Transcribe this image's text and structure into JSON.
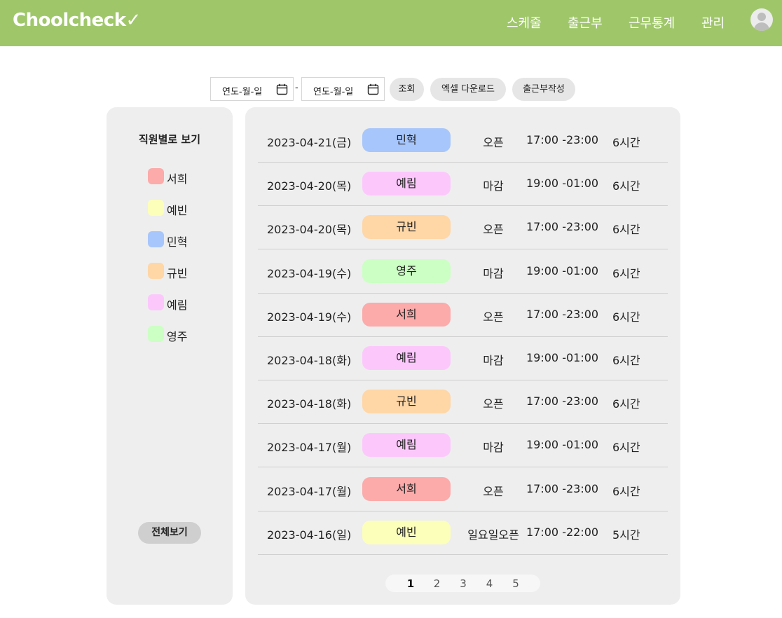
{
  "header": {
    "logo": "Choolcheck✓",
    "nav": [
      "스케줄",
      "출근부",
      "근무통계",
      "관리"
    ]
  },
  "toolbar": {
    "date_start_placeholder": "연도-월-일",
    "date_end_placeholder": "연도-월-일",
    "separator": "-",
    "search_label": "조회",
    "excel_label": "엑셀 다운로드",
    "write_label": "출근부작성"
  },
  "sidebar": {
    "title": "직원별로 보기",
    "employees": [
      {
        "name": "서희",
        "color": "#fcaaaa"
      },
      {
        "name": "예빈",
        "color": "#fcffba"
      },
      {
        "name": "민혁",
        "color": "#a7c6fb"
      },
      {
        "name": "규빈",
        "color": "#ffd6a6"
      },
      {
        "name": "예림",
        "color": "#fcc8fc"
      },
      {
        "name": "영주",
        "color": "#ccffc4"
      }
    ],
    "all_label": "전체보기"
  },
  "records": [
    {
      "date": "2023-04-21(금)",
      "name": "민혁",
      "color": "#a7c6fb",
      "type": "오픈",
      "time": "17:00 -23:00",
      "hours": "6시간"
    },
    {
      "date": "2023-04-20(목)",
      "name": "예림",
      "color": "#fcc8fc",
      "type": "마감",
      "time": "19:00 -01:00",
      "hours": "6시간"
    },
    {
      "date": "2023-04-20(목)",
      "name": "규빈",
      "color": "#ffd6a6",
      "type": "오픈",
      "time": "17:00 -23:00",
      "hours": "6시간"
    },
    {
      "date": "2023-04-19(수)",
      "name": "영주",
      "color": "#ccffc4",
      "type": "마감",
      "time": "19:00 -01:00",
      "hours": "6시간"
    },
    {
      "date": "2023-04-19(수)",
      "name": "서희",
      "color": "#fcaaaa",
      "type": "오픈",
      "time": "17:00 -23:00",
      "hours": "6시간"
    },
    {
      "date": "2023-04-18(화)",
      "name": "예림",
      "color": "#fcc8fc",
      "type": "마감",
      "time": "19:00 -01:00",
      "hours": "6시간"
    },
    {
      "date": "2023-04-18(화)",
      "name": "규빈",
      "color": "#ffd6a6",
      "type": "오픈",
      "time": "17:00 -23:00",
      "hours": "6시간"
    },
    {
      "date": "2023-04-17(월)",
      "name": "예림",
      "color": "#fcc8fc",
      "type": "마감",
      "time": "19:00 -01:00",
      "hours": "6시간"
    },
    {
      "date": "2023-04-17(월)",
      "name": "서희",
      "color": "#fcaaaa",
      "type": "오픈",
      "time": "17:00 -23:00",
      "hours": "6시간"
    },
    {
      "date": "2023-04-16(일)",
      "name": "예빈",
      "color": "#fcffba",
      "type": "일요일오픈",
      "time": "17:00 -22:00",
      "hours": "5시간"
    }
  ],
  "pagination": {
    "pages": [
      "1",
      "2",
      "3",
      "4",
      "5"
    ],
    "current": "1"
  },
  "colors": {
    "header_bg": "#9fc76a",
    "panel_bg": "#eeeeee"
  }
}
